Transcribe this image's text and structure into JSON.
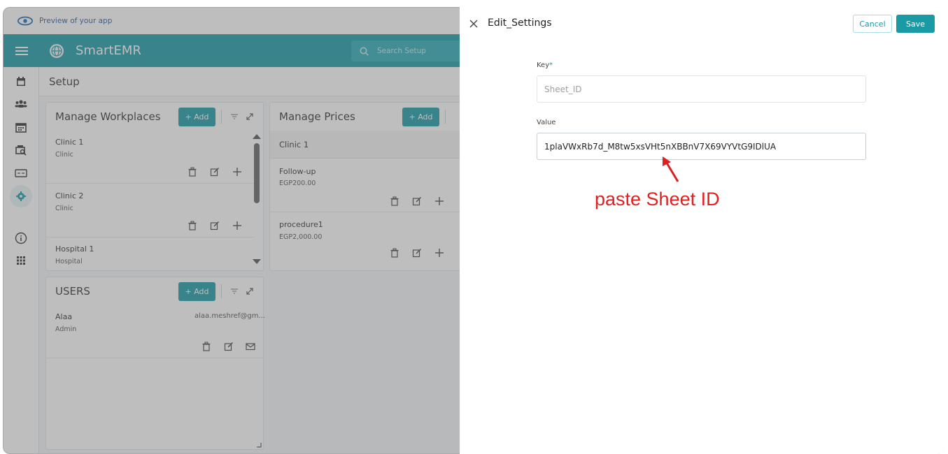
{
  "preview_bar": {
    "text": "Preview of your app"
  },
  "topbar": {
    "brand": "SmartEMR",
    "search_placeholder": "Search Setup"
  },
  "setup": {
    "title": "Setup"
  },
  "workplaces": {
    "title": "Manage Workplaces",
    "add_label": "+ Add",
    "items": [
      {
        "name": "Clinic 1",
        "type": "Clinic"
      },
      {
        "name": "Clinic 2",
        "type": "Clinic"
      },
      {
        "name": "Hospital 1",
        "type": "Hospital"
      }
    ]
  },
  "prices": {
    "title": "Manage Prices",
    "add_label": "+ Add",
    "group": "Clinic 1",
    "items": [
      {
        "name": "Follow-up",
        "price": "EGP200.00"
      },
      {
        "name": "procedure1",
        "price": "EGP2,000.00"
      }
    ]
  },
  "users": {
    "title": "USERS",
    "add_label": "+ Add",
    "items": [
      {
        "name": "Alaa",
        "email": "alaa.meshref@gm...",
        "role": "Admin"
      }
    ]
  },
  "panel": {
    "title": "Edit_Settings",
    "cancel": "Cancel",
    "save": "Save",
    "key_label": "Key",
    "key_required_mark": "*",
    "key_value": "Sheet_ID",
    "value_label": "Value",
    "value_value": "1plaVWxRb7d_M8tw5xsVHt5nXBBnV7X69VYVtG9IDlUA"
  },
  "annotation": {
    "text": "paste Sheet ID",
    "color": "#e02020"
  },
  "colors": {
    "accent": "#1a9aa5",
    "overlay": "rgba(100,100,100,0.42)"
  }
}
